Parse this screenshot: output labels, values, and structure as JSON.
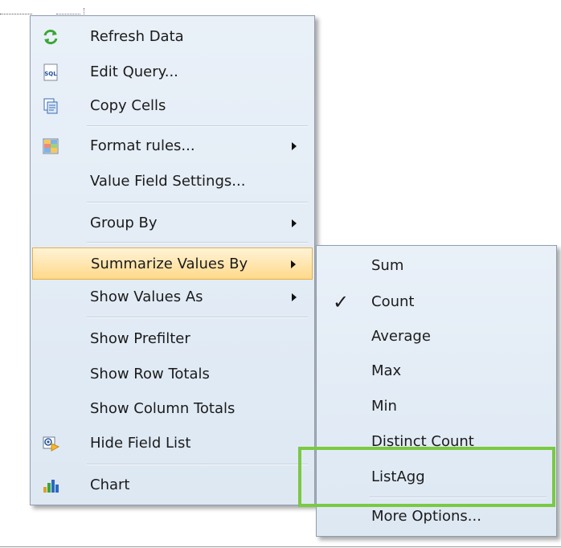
{
  "main_menu": {
    "items": [
      {
        "label": "Refresh Data",
        "icon": "refresh-icon"
      },
      {
        "label": "Edit Query...",
        "icon": "sql-icon"
      },
      {
        "label": "Copy Cells",
        "icon": "copy-icon"
      },
      {
        "label": "Format rules...",
        "icon": "format-rules-icon",
        "submenu": true
      },
      {
        "label": "Value Field Settings..."
      },
      {
        "label": "Group By",
        "submenu": true
      },
      {
        "label": "Summarize Values By",
        "submenu": true,
        "highlighted": true
      },
      {
        "label": "Show Values As",
        "submenu": true
      },
      {
        "label": "Show Prefilter"
      },
      {
        "label": "Show Row Totals"
      },
      {
        "label": "Show Column Totals"
      },
      {
        "label": "Hide Field List",
        "icon": "hide-field-list-icon"
      },
      {
        "label": "Chart",
        "icon": "chart-icon"
      }
    ]
  },
  "sub_menu": {
    "items": [
      {
        "label": "Sum"
      },
      {
        "label": "Count",
        "checked": true
      },
      {
        "label": "Average"
      },
      {
        "label": "Max"
      },
      {
        "label": "Min"
      },
      {
        "label": "Distinct Count"
      },
      {
        "label": "ListAgg"
      },
      {
        "label": "More Options..."
      }
    ],
    "check_mark": "✓"
  },
  "colors": {
    "menu_bg": "#e4edf6",
    "hover_bg": "#ffd98a",
    "highlight_box": "#7ac943"
  }
}
